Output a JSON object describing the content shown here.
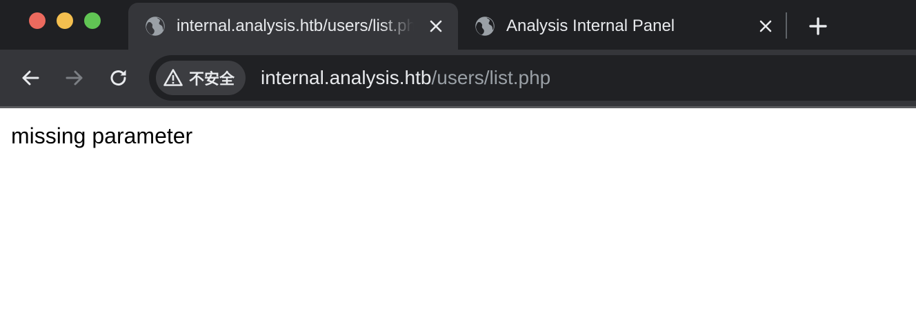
{
  "browser": {
    "tabs": [
      {
        "title": "internal.analysis.htb/users/list.php",
        "active": true,
        "icon": "globe-icon"
      },
      {
        "title": "Analysis Internal Panel",
        "active": false,
        "icon": "globe-icon"
      }
    ],
    "new_tab_icon": "plus-icon",
    "nav": {
      "back_icon": "arrow-left-icon",
      "forward_icon": "arrow-right-icon",
      "reload_icon": "reload-icon"
    },
    "address_bar": {
      "security_label": "不安全",
      "security_icon": "warning-triangle-icon",
      "url_host": "internal.analysis.htb",
      "url_path": "/users/list.php"
    },
    "colors": {
      "tabstrip_bg": "#1f2023",
      "toolbar_bg": "#35363a",
      "omnibox_bg": "#202124",
      "text_primary": "#e8eaed",
      "text_secondary": "#9aa0a6",
      "traffic_close": "#ec6a5e",
      "traffic_minimize": "#f4bf4f",
      "traffic_maximize": "#61c554"
    }
  },
  "page": {
    "message": "missing parameter"
  }
}
